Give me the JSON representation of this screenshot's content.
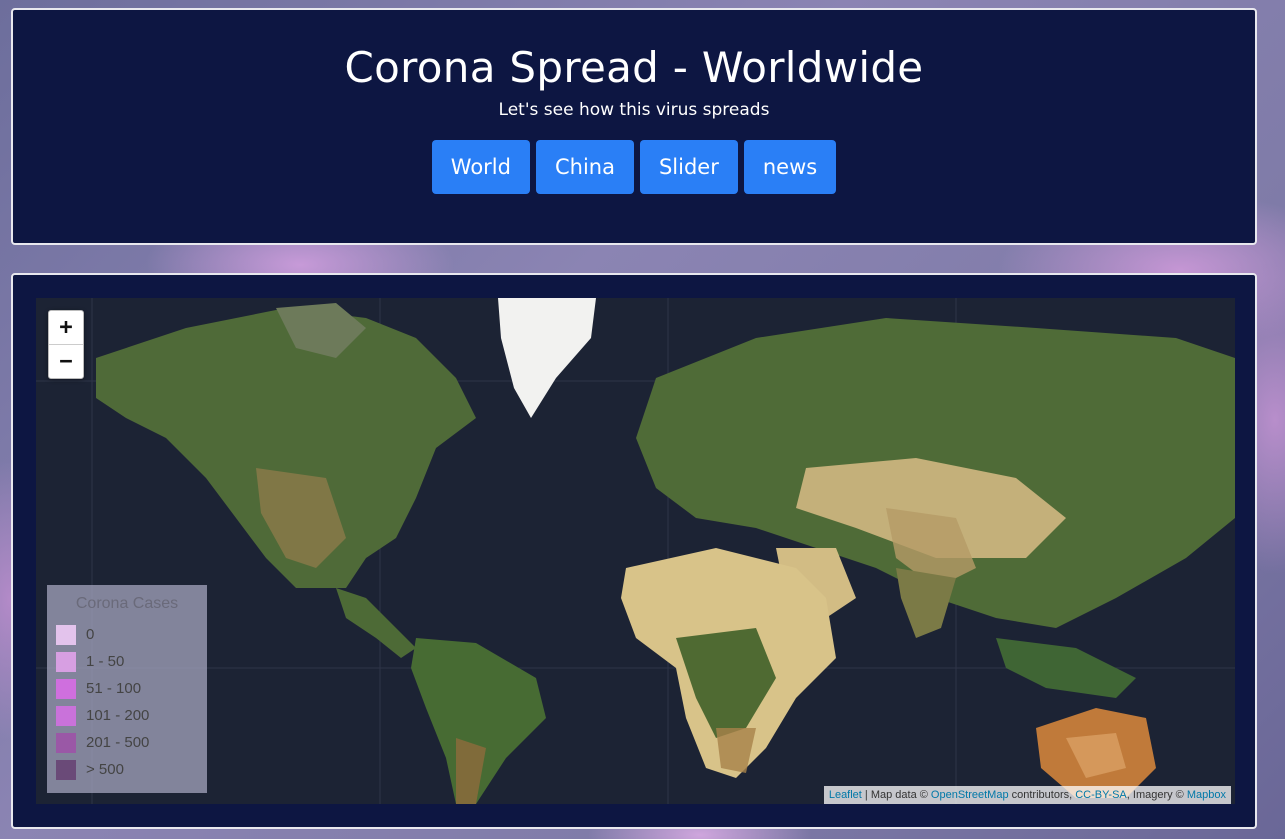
{
  "header": {
    "title": "Corona Spread - Worldwide",
    "subtitle": "Let's see how this virus spreads",
    "nav": [
      "World",
      "China",
      "Slider",
      "news"
    ]
  },
  "map": {
    "zoom_in": "+",
    "zoom_out": "−",
    "legend": {
      "title": "Corona Cases",
      "items": [
        {
          "label": "0",
          "color": "#e3c3ec"
        },
        {
          "label": "1 - 50",
          "color": "#d79fe2"
        },
        {
          "label": "51 - 100",
          "color": "#cf6fde"
        },
        {
          "label": "101 - 200",
          "color": "#c972da"
        },
        {
          "label": "201 - 500",
          "color": "#9a58a6"
        },
        {
          "label": "> 500",
          "color": "#6a4a78"
        }
      ]
    },
    "attribution": {
      "leaflet": "Leaflet",
      "sep1": " | Map data © ",
      "osm": "OpenStreetMap",
      "sep2": " contributors, ",
      "license": "CC-BY-SA",
      "sep3": ", Imagery © ",
      "mapbox": "Mapbox"
    }
  }
}
